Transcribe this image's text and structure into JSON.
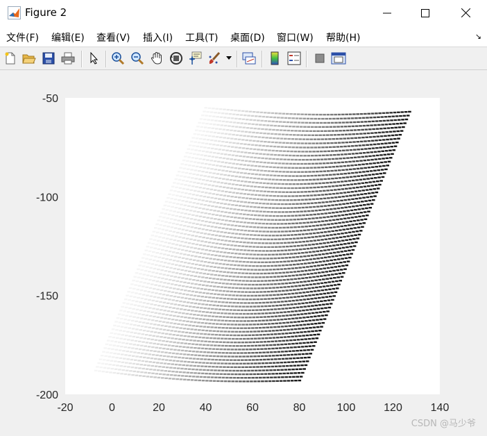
{
  "window": {
    "title": "Figure 2"
  },
  "menu": {
    "items": [
      "文件(F)",
      "编辑(E)",
      "查看(V)",
      "插入(I)",
      "工具(T)",
      "桌面(D)",
      "窗口(W)",
      "帮助(H)"
    ]
  },
  "toolbar": {
    "buttons": [
      "new-figure-icon",
      "open-file-icon",
      "save-icon",
      "print-icon",
      "edit-plot-pointer-icon",
      "zoom-in-icon",
      "zoom-out-icon",
      "pan-hand-icon",
      "rotate-3d-icon",
      "data-cursor-icon",
      "brush-icon",
      "link-plot-icon",
      "insert-colorbar-icon",
      "insert-legend-icon",
      "hide-plot-tools-icon",
      "show-plot-tools-icon"
    ]
  },
  "chart_data": {
    "type": "scatter",
    "title": "",
    "xlabel": "",
    "ylabel": "",
    "xlim": [
      -20,
      140
    ],
    "ylim": [
      -200,
      -50
    ],
    "xticks": [
      -20,
      0,
      20,
      40,
      60,
      80,
      100,
      120,
      140
    ],
    "yticks": [
      -50,
      -100,
      -150,
      -200
    ],
    "xtick_labels": [
      "-20",
      "0",
      "20",
      "40",
      "60",
      "80",
      "100",
      "120",
      "140"
    ],
    "ytick_labels": [
      "-50",
      "-100",
      "-150",
      "-200"
    ],
    "grid": false,
    "colormap": "grayscale (light to dark)",
    "series": [
      {
        "points_description": "dense rows of points forming a slanted parallelogram from about (-7,-188)…(80,-193) at the bottom to (40,-55)…(127,-57) at the top",
        "corners": [
          [
            -7,
            -188
          ],
          [
            80,
            -193
          ],
          [
            127,
            -57
          ],
          [
            40,
            -55
          ]
        ]
      }
    ]
  },
  "watermark": "CSDN @马少爷"
}
